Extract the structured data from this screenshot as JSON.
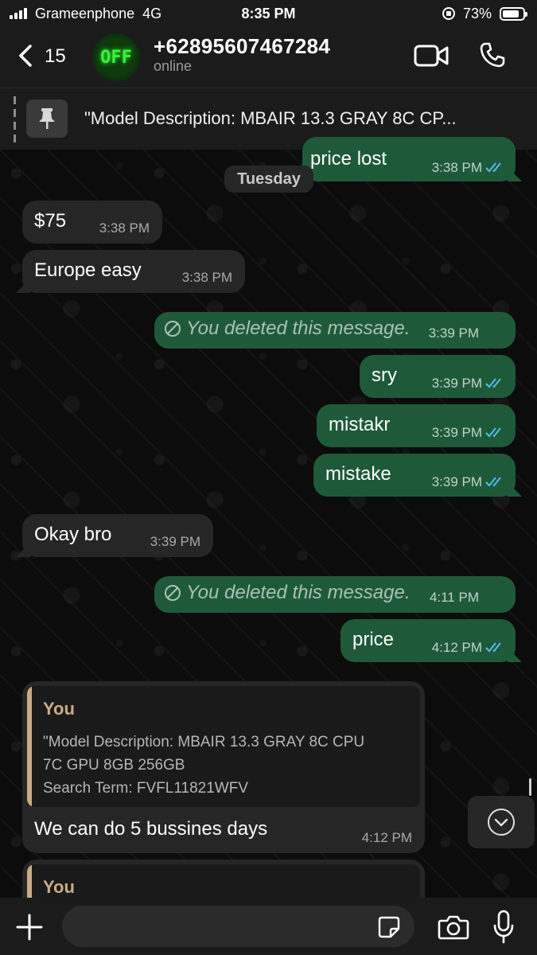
{
  "status_bar": {
    "carrier": "Grameenphone",
    "network": "4G",
    "time": "8:35 PM",
    "battery": "73%"
  },
  "header": {
    "back_count": "15",
    "avatar_text": "OFF",
    "contact_name": "+62895607467284",
    "contact_status": "online"
  },
  "pinned": {
    "text": "\"Model Description: MBAIR 13.3 GRAY 8C CP..."
  },
  "date_separator": "Tuesday",
  "messages": [
    {
      "direction": "out",
      "text": "price lost",
      "time": "3:38 PM",
      "read": true
    },
    {
      "direction": "in",
      "text": "$75",
      "time": "3:38 PM"
    },
    {
      "direction": "in",
      "text": "Europe easy",
      "time": "3:38 PM"
    },
    {
      "direction": "out",
      "text": "You deleted this message.",
      "time": "3:39 PM",
      "deleted": true
    },
    {
      "direction": "out",
      "text": "sry",
      "time": "3:39 PM",
      "read": true
    },
    {
      "direction": "out",
      "text": "mistakr",
      "time": "3:39 PM",
      "read": true
    },
    {
      "direction": "out",
      "text": "mistake",
      "time": "3:39 PM",
      "read": true
    },
    {
      "direction": "in",
      "text": "Okay bro",
      "time": "3:39 PM"
    },
    {
      "direction": "out",
      "text": "You deleted this message.",
      "time": "4:11 PM",
      "deleted": true
    },
    {
      "direction": "out",
      "text": "price",
      "time": "4:12 PM",
      "read": true
    },
    {
      "direction": "in",
      "quote": {
        "author": "You",
        "lines": [
          "\"Model Description: MBAIR 13.3 GRAY 8C CPU",
          "7C GPU 8GB 256GB",
          "Search Term: FVFL11821WFV"
        ]
      },
      "text": "We can do 5 bussines days",
      "time": "4:12 PM"
    },
    {
      "direction": "in",
      "quote": {
        "author": "You"
      }
    }
  ],
  "input": {
    "placeholder": "",
    "value": ""
  },
  "colors": {
    "outgoing_bubble": "#1e5a3a",
    "incoming_bubble": "#262626",
    "read_ticks": "#53bdeb",
    "quote_accent": "#c8ac85",
    "avatar_text": "#3df03d"
  },
  "icons": [
    "back-chevron-icon",
    "video-call-icon",
    "phone-call-icon",
    "pin-icon",
    "read-ticks-icon",
    "deleted-icon",
    "scroll-down-icon",
    "plus-icon",
    "sticker-icon",
    "camera-icon",
    "mic-icon"
  ]
}
